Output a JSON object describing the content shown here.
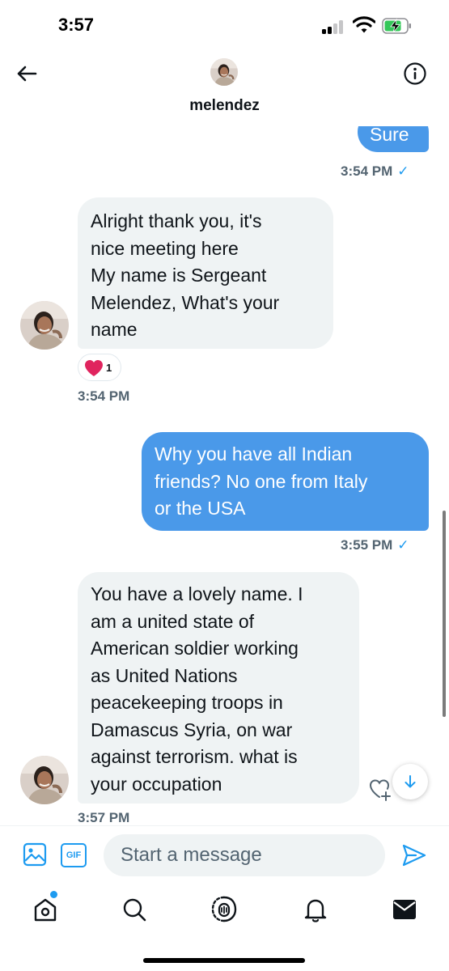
{
  "status_bar": {
    "time": "3:57"
  },
  "header": {
    "contact_name": "melendez"
  },
  "messages": [
    {
      "direction": "out",
      "text": "Sure",
      "timestamp": "3:54 PM",
      "read": "✓"
    },
    {
      "direction": "in",
      "text": "Alright thank you, it's\nnice meeting here\nMy name is Sergeant\nMelendez, What's your\nname",
      "timestamp": "3:54 PM",
      "reaction": {
        "emoji": "heart",
        "count": "1"
      }
    },
    {
      "direction": "out",
      "text": "Why you have all Indian\nfriends? No one from Italy\nor the USA",
      "timestamp": "3:55 PM",
      "read": "✓"
    },
    {
      "direction": "in",
      "text": "You have a lovely name. I\nam a united state of\nAmerican soldier working\nas United Nations\npeacekeeping troops in\nDamascus Syria, on war\nagainst terrorism. what is\nyour occupation",
      "timestamp": "3:57 PM"
    }
  ],
  "composer": {
    "placeholder": "Start a message",
    "gif_label": "GIF"
  },
  "tabs": [
    {
      "icon": "home-icon"
    },
    {
      "icon": "search-icon"
    },
    {
      "icon": "spaces-icon"
    },
    {
      "icon": "notifications-icon"
    },
    {
      "icon": "messages-icon"
    }
  ],
  "colors": {
    "accent": "#1d9bf0",
    "outgoing_bubble": "#4a99e9",
    "incoming_bubble": "#eff3f4",
    "muted_text": "#536471",
    "heart": "#e0245e"
  }
}
